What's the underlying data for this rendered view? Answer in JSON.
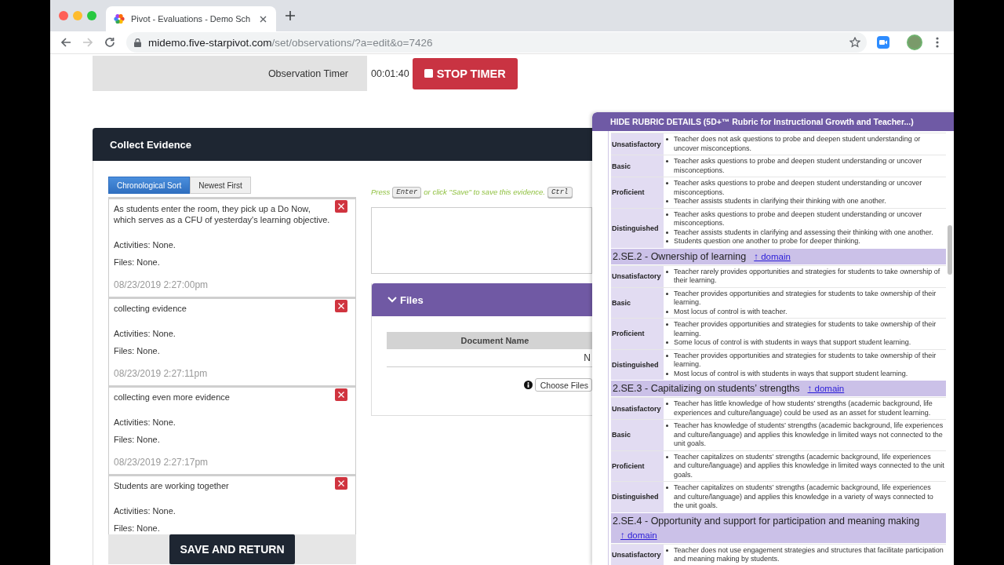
{
  "browser": {
    "tab": {
      "title": "Pivot - Evaluations - Demo Sch"
    },
    "nav": [
      {
        "kind": "back",
        "disabled": false
      },
      {
        "kind": "forward",
        "disabled": true
      },
      {
        "kind": "reload",
        "disabled": false
      }
    ],
    "url": {
      "host": "midemo.five-starpivot.com",
      "path": "/set/observations/?a=edit&o=7426"
    }
  },
  "timer": {
    "label": "Observation Timer",
    "elapsed": "00:01:40",
    "button": "STOP TIMER"
  },
  "collect_evidence": {
    "title": "Collect Evidence",
    "sort_options": [
      {
        "label": "Chronological Sort",
        "selected": true
      },
      {
        "label": "Newest First",
        "selected": false
      }
    ],
    "entries": [
      {
        "text": "As students enter the room, they pick up a Do Now, which serves as a CFU of yesterday's learning objective.",
        "activities": "Activities: None.",
        "files": "Files: None.",
        "time": "08/23/2019 2:27:00pm"
      },
      {
        "text": "collecting evidence",
        "activities": "Activities: None.",
        "files": "Files: None.",
        "time": "08/23/2019 2:27:11pm"
      },
      {
        "text": "collecting even more evidence",
        "activities": "Activities: None.",
        "files": "Files: None.",
        "time": "08/23/2019 2:27:17pm"
      },
      {
        "text": "Students are working together",
        "activities": "Activities: None.",
        "files": "Files: None."
      }
    ],
    "save_button": "SAVE AND RETURN",
    "hint": [
      {
        "kind": "text",
        "text": "Press"
      },
      {
        "kind": "key",
        "text": "Enter"
      },
      {
        "kind": "text",
        "text": "or click \"Save\" to save this evidence."
      },
      {
        "kind": "key",
        "text": "Ctrl"
      }
    ],
    "files": {
      "title": "Files",
      "expanded": true,
      "column": "Document Name",
      "cell": "N",
      "choose_button": "Choose Files"
    }
  },
  "rubric": {
    "toggle": "HIDE RUBRIC DETAILS (5D+™ Rubric for Instructional Growth and Teacher...)",
    "sections": [
      {
        "rows": [
          {
            "rating": "Unsatisfactory",
            "descriptors": [
              "Teacher does not ask questions to probe and deepen student understanding or uncover misconceptions."
            ]
          },
          {
            "rating": "Basic",
            "descriptors": [
              "Teacher asks questions to probe and deepen student understanding or uncover misconceptions."
            ]
          },
          {
            "rating": "Proficient",
            "descriptors": [
              "Teacher asks questions to probe and deepen student understanding or uncover misconceptions.",
              "Teacher assists students in clarifying their thinking with one another."
            ]
          },
          {
            "rating": "Distinguished",
            "descriptors": [
              "Teacher asks questions to probe and deepen student understanding or uncover misconceptions.",
              "Teacher assists students in clarifying and assessing their thinking with one another.",
              "Students question one another to probe for deeper thinking."
            ]
          }
        ]
      },
      {
        "title": "2.SE.2 - Ownership of learning",
        "link": "↑ domain",
        "rows": [
          {
            "rating": "Unsatisfactory",
            "descriptors": [
              "Teacher rarely provides opportunities and strategies for students to take ownership of their learning."
            ]
          },
          {
            "rating": "Basic",
            "descriptors": [
              "Teacher provides opportunities and strategies for students to take ownership of their learning.",
              "Most locus of control is with teacher."
            ]
          },
          {
            "rating": "Proficient",
            "descriptors": [
              "Teacher provides opportunities and strategies for students to take ownership of their learning.",
              "Some locus of control is with students in ways that support student learning."
            ]
          },
          {
            "rating": "Distinguished",
            "descriptors": [
              "Teacher provides opportunities and strategies for students to take ownership of their learning.",
              "Most locus of control is with students in ways that support student learning."
            ]
          }
        ]
      },
      {
        "title": "2.SE.3 - Capitalizing on students’ strengths",
        "link": "↑ domain",
        "rows": [
          {
            "rating": "Unsatisfactory",
            "descriptors": [
              "Teacher has little knowledge of how students’ strengths (academic background, life experiences and culture/language) could be used as an asset for student learning."
            ]
          },
          {
            "rating": "Basic",
            "descriptors": [
              "Teacher has knowledge of students’ strengths (academic background, life experiences and culture/language) and applies this knowledge in limited ways not connected to the unit goals."
            ]
          },
          {
            "rating": "Proficient",
            "descriptors": [
              "Teacher capitalizes on students’ strengths (academic background, life experiences and culture/language) and applies this knowledge in limited ways connected to the unit goals."
            ]
          },
          {
            "rating": "Distinguished",
            "descriptors": [
              "Teacher capitalizes on students’ strengths (academic background, life experiences and culture/language) and applies this knowledge in a variety of ways connected to the unit goals."
            ]
          }
        ]
      },
      {
        "title": "2.SE.4 - Opportunity and support for participation and meaning making",
        "link": "↑ domain",
        "rows": [
          {
            "rating": "Unsatisfactory",
            "descriptors": [
              "Teacher does not use engagement strategies and structures that facilitate participation and meaning making by students."
            ]
          }
        ]
      }
    ]
  }
}
